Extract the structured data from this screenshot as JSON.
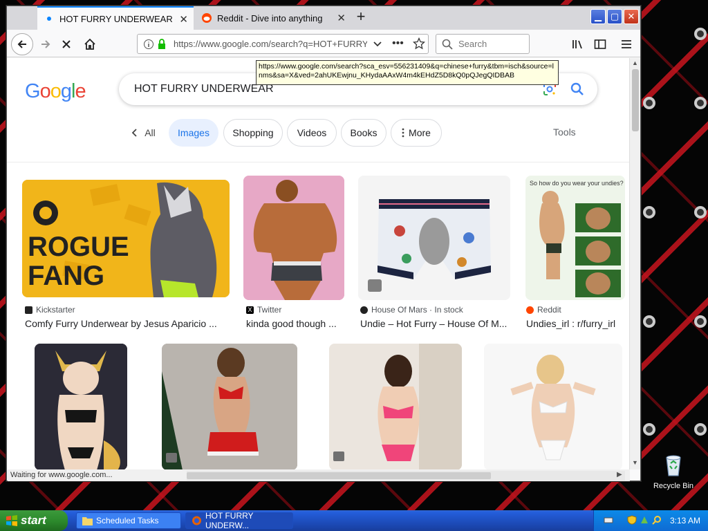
{
  "browser": {
    "tabs": [
      {
        "label": "HOT FURRY UNDERWEAR - Google",
        "active": true
      },
      {
        "label": "Reddit - Dive into anything",
        "active": false
      }
    ],
    "url": "https://www.google.com/search?q=HOT+FURRY",
    "url_hover_tooltip": "https://www.google.com/search?sca_esv=556231409&q=chinese+furry&tbm=isch&source=lnms&sa=X&ved=2ahUKEwjnu_KHydaAAxW4m4kEHdZ5D8kQ0pQJegQIDBAB",
    "search_placeholder": "Search",
    "status_text": "Waiting for www.google.com..."
  },
  "google": {
    "logo": "Google",
    "query": "HOT FURRY UNDERWEAR",
    "filters": {
      "all": "All",
      "images": "Images",
      "shopping": "Shopping",
      "videos": "Videos",
      "books": "Books",
      "more": "More",
      "tools": "Tools"
    },
    "results_row1": [
      {
        "source": "Kickstarter",
        "title": "Comfy Furry Underwear by Jesus Aparicio ..."
      },
      {
        "source": "Twitter",
        "title": "kinda good though ..."
      },
      {
        "source": "House Of Mars · In stock",
        "title": "Undie – Hot Furry – House Of M..."
      },
      {
        "source": "Reddit",
        "title": "Undies_irl : r/furry_irl"
      }
    ],
    "image_texts": {
      "rogue_line1": "ROGUE",
      "rogue_line2": "FANG",
      "undies_caption": "So how do you wear your undies?"
    }
  },
  "taskbar": {
    "start_label": "start",
    "tasks": [
      {
        "label": "Scheduled Tasks"
      },
      {
        "label": "HOT FURRY UNDERW..."
      }
    ],
    "clock": "3:13 AM"
  },
  "desktop": {
    "recycle_bin_label": "Recycle Bin"
  },
  "colors": {
    "google_blue": "#4285F4",
    "google_red": "#EA4335",
    "google_yellow": "#FBBC05",
    "google_green": "#34A853",
    "chip_active_bg": "#e8f0fe",
    "xp_taskbar": "#245edb",
    "xp_start": "#2d8a2d"
  }
}
